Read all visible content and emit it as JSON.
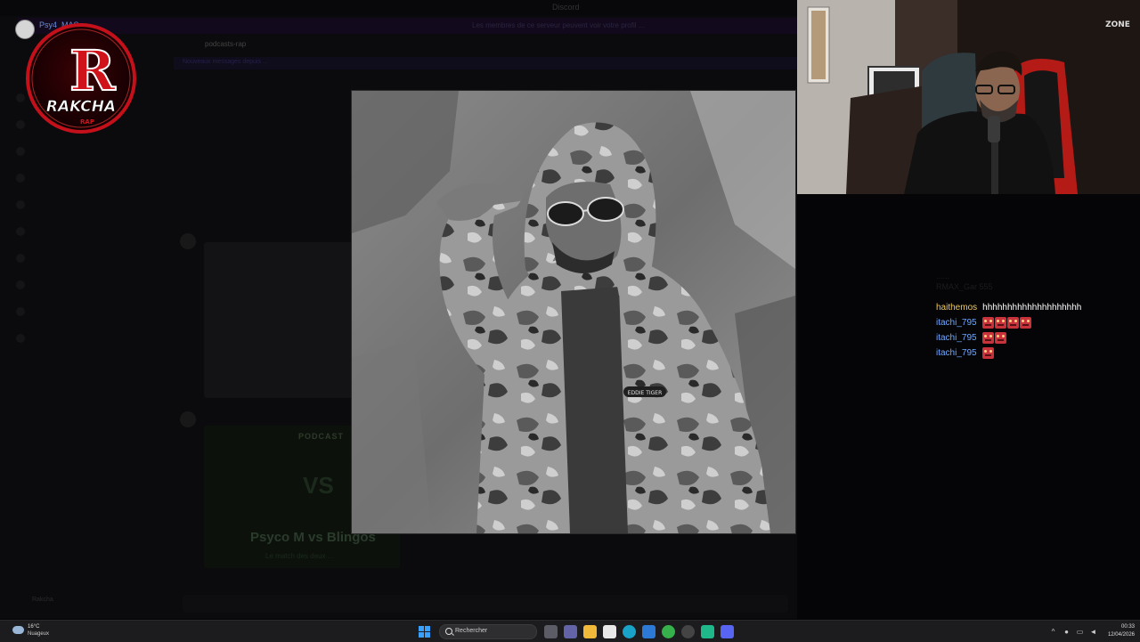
{
  "background_app": {
    "window_title": "Discord",
    "user_name": "Psy4_MAS",
    "user_status": "",
    "topbar_notice": "Les membres de ce serveur peuvent voir votre profil ...",
    "channel_header": "podcasts-rap",
    "banner_text": "Nouveaux messages depuis ...",
    "post_card_tag": "PODCAST",
    "post_card_vs": "VS",
    "post_card_title": "Psyco M vs Blingos",
    "post_card_subtitle": "Le match des deux ...",
    "footer_user": "Rakcha"
  },
  "overlay": {
    "logo_text": "RAKCHA",
    "logo_letter": "R",
    "logo_subtext": "RAP"
  },
  "chat": {
    "faded_lines": [
      "......",
      "RMAX_Gar 555"
    ],
    "messages": [
      {
        "user": "haithemos",
        "user_color": "#f2c85b",
        "text": "hhhhhhhhhhhhhhhhhhhh",
        "emotes": 0
      },
      {
        "user": "itachi_795",
        "user_color": "#6fa8ff",
        "text": "",
        "emotes": 4
      },
      {
        "user": "itachi_795",
        "user_color": "#6fa8ff",
        "text": "",
        "emotes": 2
      },
      {
        "user": "itachi_795",
        "user_color": "#6fa8ff",
        "text": "",
        "emotes": 1
      }
    ]
  },
  "taskbar": {
    "weather_temp": "16°C",
    "weather_condition": "Nuageux",
    "search_placeholder": "Rechercher",
    "time": "00:33",
    "date": "12/04/2026"
  },
  "colors": {
    "accent": "#3aa0ff",
    "logo_red": "#d0121b",
    "chat_user_yellow": "#f2c85b",
    "chat_user_blue": "#6fa8ff"
  }
}
